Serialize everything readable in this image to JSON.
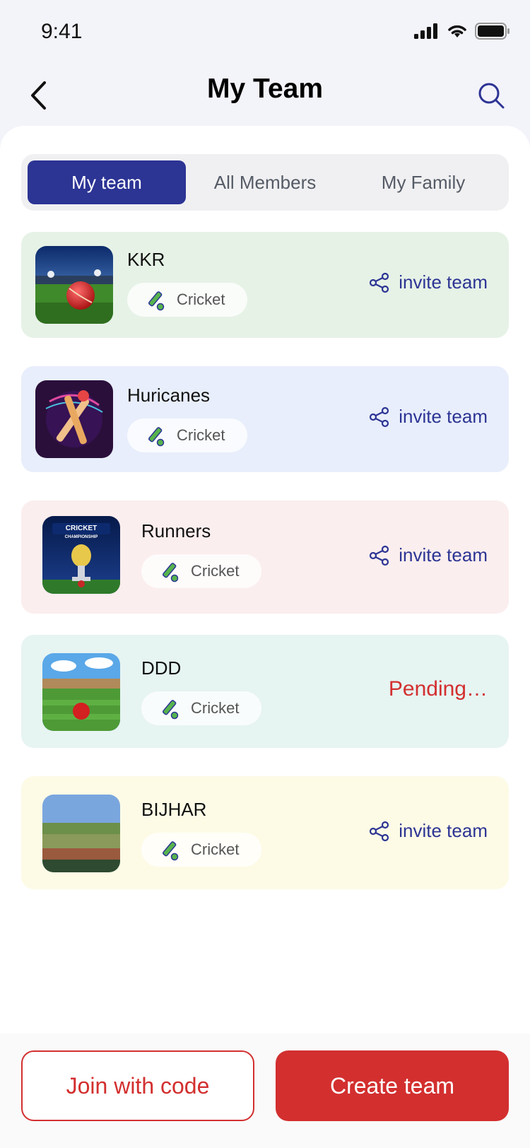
{
  "status_bar": {
    "time": "9:41",
    "icons": [
      "signal-icon",
      "wifi-icon",
      "battery-icon"
    ]
  },
  "header": {
    "title": "My Team",
    "back_icon": "chevron-left-icon",
    "search_icon": "search-icon"
  },
  "tabs": [
    {
      "label": "My team",
      "active": true
    },
    {
      "label": "All Members",
      "active": false
    },
    {
      "label": "My Family",
      "active": false
    }
  ],
  "teams": [
    {
      "name": "KKR",
      "sport": "Cricket",
      "action": "invite team",
      "bg": "#e6f2e6"
    },
    {
      "name": "Huricanes",
      "sport": "Cricket",
      "action": "invite team",
      "bg": "#e8eefb"
    },
    {
      "name": "Runners",
      "sport": "Cricket",
      "action": "invite team",
      "bg": "#fbeeee"
    },
    {
      "name": "DDD",
      "sport": "Cricket",
      "status": "Pending…",
      "bg": "#e6f4f2"
    },
    {
      "name": "BIJHAR",
      "sport": "Cricket",
      "action": "invite team",
      "bg": "#fdfbe6"
    }
  ],
  "footer": {
    "join_label": "Join with code",
    "create_label": "Create team"
  },
  "colors": {
    "primary": "#2c3494",
    "accent_red": "#d32f2f"
  }
}
